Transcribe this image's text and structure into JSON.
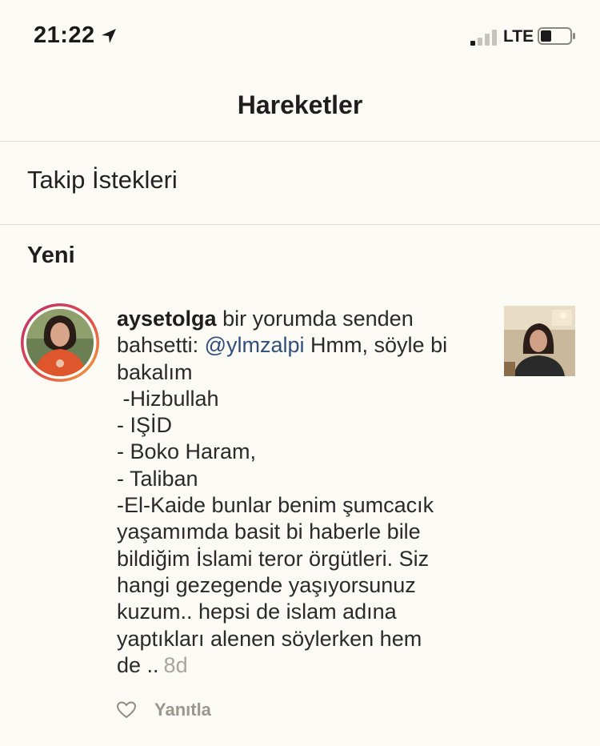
{
  "status_bar": {
    "time": "21:22",
    "carrier": "LTE",
    "icons": [
      "location-arrow-icon",
      "signal-bars-icon",
      "battery-icon"
    ]
  },
  "nav": {
    "title": "Hareketler"
  },
  "follow_requests": {
    "label": "Takip İstekleri"
  },
  "section": {
    "title": "Yeni"
  },
  "notification": {
    "username": "aysetolga",
    "action_text": "bir yorumda senden",
    "line2_prefix": "bahsetti:",
    "mention": "@ylmzalpi",
    "line2_suffix": "Hmm, söyle bi",
    "lines": [
      "bakalım",
      " -Hizbullah",
      "- IŞİD",
      "- Boko Haram,",
      "- Taliban",
      "-El-Kaide bunlar benim şumcacık",
      "yaşamımda basit bi haberle bile",
      "bildiğim İslami teror örgütleri. Siz",
      "hangi gezegende yaşıyorsunuz",
      "kuzum.. hepsi de islam adına",
      "yaptıkları alenen söylerken hem"
    ],
    "last_line": "de ..",
    "time_ago": "8d",
    "reply_label": "Yanıtla"
  },
  "colors": {
    "background": "#fbfaf4",
    "mention": "#2f4f7a",
    "muted": "#a9a59a",
    "story_ring_start": "#c2336e",
    "story_ring_end": "#f2a33a"
  }
}
